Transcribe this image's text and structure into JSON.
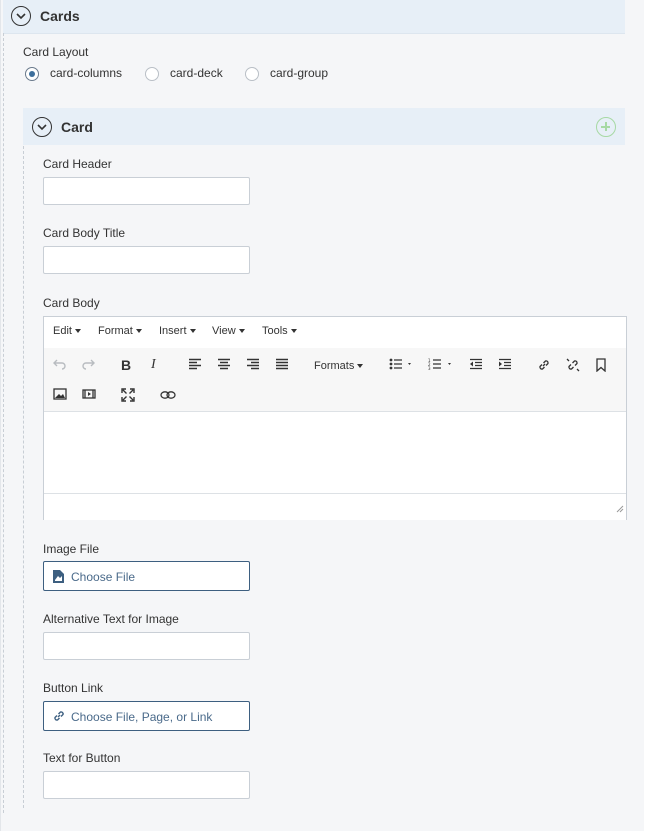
{
  "section": {
    "title": "Cards"
  },
  "card_layout": {
    "label": "Card Layout",
    "options": [
      {
        "label": "card-columns",
        "selected": true
      },
      {
        "label": "card-deck",
        "selected": false
      },
      {
        "label": "card-group",
        "selected": false
      }
    ]
  },
  "card": {
    "title": "Card",
    "header_label": "Card Header",
    "header_value": "",
    "body_title_label": "Card Body Title",
    "body_title_value": "",
    "body_label": "Card Body",
    "editor": {
      "menus": [
        "Edit",
        "Format",
        "Insert",
        "View",
        "Tools"
      ],
      "formats_label": "Formats",
      "content": ""
    },
    "image_file_label": "Image File",
    "image_file_button": "Choose File",
    "alt_text_label": "Alternative Text for Image",
    "alt_text_value": "",
    "button_link_label": "Button Link",
    "button_link_button": "Choose File, Page, or Link",
    "button_text_label": "Text for Button",
    "button_text_value": ""
  },
  "colors": {
    "header_bg": "#e7eff7",
    "panel_bg": "#f5f6f8",
    "radio_selected": "#3d6f9c",
    "add_icon": "#a7d9a4",
    "picker_border": "#3d5f80"
  }
}
